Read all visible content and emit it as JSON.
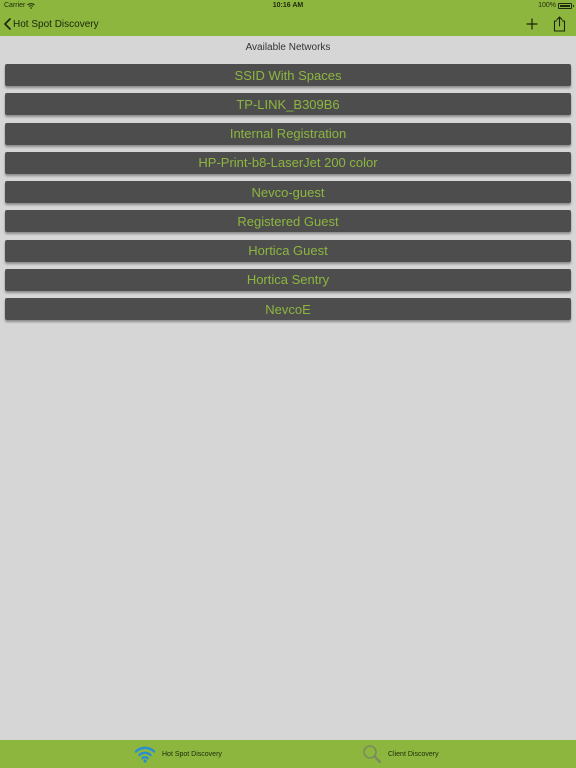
{
  "status_bar": {
    "carrier": "Carrier",
    "time": "10:16 AM",
    "battery": "100%"
  },
  "nav": {
    "back_label": "Hot Spot Discovery",
    "add_icon": "plus-icon",
    "share_icon": "share-icon"
  },
  "list": {
    "heading": "Available Networks",
    "networks": [
      "SSID With Spaces",
      "TP-LINK_B309B6",
      "Internal Registration",
      "HP-Print-b8-LaserJet 200 color",
      "Nevco-guest",
      "Registered Guest",
      "Hortica Guest",
      "Hortica Sentry",
      "NevcoE"
    ]
  },
  "tabs": [
    {
      "label": "Hot Spot Discovery",
      "icon": "wifi-icon",
      "selected": true
    },
    {
      "label": "Client Discovery",
      "icon": "magnifier-icon",
      "selected": false
    }
  ],
  "colors": {
    "accent": "#8db63f",
    "button_bg": "#4d4d4d",
    "page_bg": "#d6d6d6",
    "selected_icon": "#2a8fcf"
  }
}
